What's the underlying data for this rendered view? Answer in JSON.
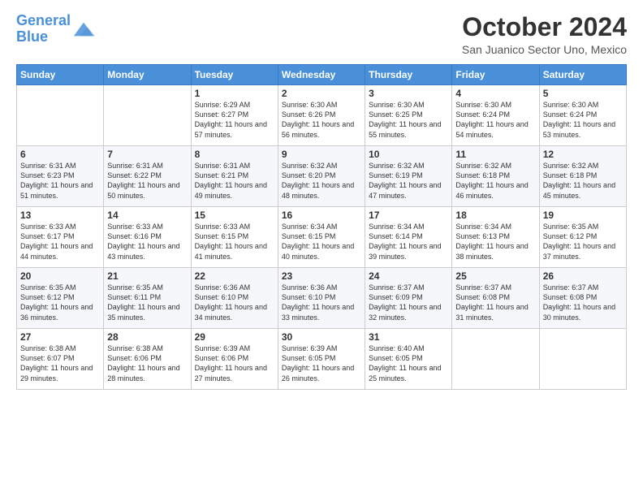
{
  "logo": {
    "line1": "General",
    "line2": "Blue"
  },
  "title": "October 2024",
  "subtitle": "San Juanico Sector Uno, Mexico",
  "header_days": [
    "Sunday",
    "Monday",
    "Tuesday",
    "Wednesday",
    "Thursday",
    "Friday",
    "Saturday"
  ],
  "weeks": [
    [
      {
        "day": "",
        "info": ""
      },
      {
        "day": "",
        "info": ""
      },
      {
        "day": "1",
        "info": "Sunrise: 6:29 AM\nSunset: 6:27 PM\nDaylight: 11 hours and 57 minutes."
      },
      {
        "day": "2",
        "info": "Sunrise: 6:30 AM\nSunset: 6:26 PM\nDaylight: 11 hours and 56 minutes."
      },
      {
        "day": "3",
        "info": "Sunrise: 6:30 AM\nSunset: 6:25 PM\nDaylight: 11 hours and 55 minutes."
      },
      {
        "day": "4",
        "info": "Sunrise: 6:30 AM\nSunset: 6:24 PM\nDaylight: 11 hours and 54 minutes."
      },
      {
        "day": "5",
        "info": "Sunrise: 6:30 AM\nSunset: 6:24 PM\nDaylight: 11 hours and 53 minutes."
      }
    ],
    [
      {
        "day": "6",
        "info": "Sunrise: 6:31 AM\nSunset: 6:23 PM\nDaylight: 11 hours and 51 minutes."
      },
      {
        "day": "7",
        "info": "Sunrise: 6:31 AM\nSunset: 6:22 PM\nDaylight: 11 hours and 50 minutes."
      },
      {
        "day": "8",
        "info": "Sunrise: 6:31 AM\nSunset: 6:21 PM\nDaylight: 11 hours and 49 minutes."
      },
      {
        "day": "9",
        "info": "Sunrise: 6:32 AM\nSunset: 6:20 PM\nDaylight: 11 hours and 48 minutes."
      },
      {
        "day": "10",
        "info": "Sunrise: 6:32 AM\nSunset: 6:19 PM\nDaylight: 11 hours and 47 minutes."
      },
      {
        "day": "11",
        "info": "Sunrise: 6:32 AM\nSunset: 6:18 PM\nDaylight: 11 hours and 46 minutes."
      },
      {
        "day": "12",
        "info": "Sunrise: 6:32 AM\nSunset: 6:18 PM\nDaylight: 11 hours and 45 minutes."
      }
    ],
    [
      {
        "day": "13",
        "info": "Sunrise: 6:33 AM\nSunset: 6:17 PM\nDaylight: 11 hours and 44 minutes."
      },
      {
        "day": "14",
        "info": "Sunrise: 6:33 AM\nSunset: 6:16 PM\nDaylight: 11 hours and 43 minutes."
      },
      {
        "day": "15",
        "info": "Sunrise: 6:33 AM\nSunset: 6:15 PM\nDaylight: 11 hours and 41 minutes."
      },
      {
        "day": "16",
        "info": "Sunrise: 6:34 AM\nSunset: 6:15 PM\nDaylight: 11 hours and 40 minutes."
      },
      {
        "day": "17",
        "info": "Sunrise: 6:34 AM\nSunset: 6:14 PM\nDaylight: 11 hours and 39 minutes."
      },
      {
        "day": "18",
        "info": "Sunrise: 6:34 AM\nSunset: 6:13 PM\nDaylight: 11 hours and 38 minutes."
      },
      {
        "day": "19",
        "info": "Sunrise: 6:35 AM\nSunset: 6:12 PM\nDaylight: 11 hours and 37 minutes."
      }
    ],
    [
      {
        "day": "20",
        "info": "Sunrise: 6:35 AM\nSunset: 6:12 PM\nDaylight: 11 hours and 36 minutes."
      },
      {
        "day": "21",
        "info": "Sunrise: 6:35 AM\nSunset: 6:11 PM\nDaylight: 11 hours and 35 minutes."
      },
      {
        "day": "22",
        "info": "Sunrise: 6:36 AM\nSunset: 6:10 PM\nDaylight: 11 hours and 34 minutes."
      },
      {
        "day": "23",
        "info": "Sunrise: 6:36 AM\nSunset: 6:10 PM\nDaylight: 11 hours and 33 minutes."
      },
      {
        "day": "24",
        "info": "Sunrise: 6:37 AM\nSunset: 6:09 PM\nDaylight: 11 hours and 32 minutes."
      },
      {
        "day": "25",
        "info": "Sunrise: 6:37 AM\nSunset: 6:08 PM\nDaylight: 11 hours and 31 minutes."
      },
      {
        "day": "26",
        "info": "Sunrise: 6:37 AM\nSunset: 6:08 PM\nDaylight: 11 hours and 30 minutes."
      }
    ],
    [
      {
        "day": "27",
        "info": "Sunrise: 6:38 AM\nSunset: 6:07 PM\nDaylight: 11 hours and 29 minutes."
      },
      {
        "day": "28",
        "info": "Sunrise: 6:38 AM\nSunset: 6:06 PM\nDaylight: 11 hours and 28 minutes."
      },
      {
        "day": "29",
        "info": "Sunrise: 6:39 AM\nSunset: 6:06 PM\nDaylight: 11 hours and 27 minutes."
      },
      {
        "day": "30",
        "info": "Sunrise: 6:39 AM\nSunset: 6:05 PM\nDaylight: 11 hours and 26 minutes."
      },
      {
        "day": "31",
        "info": "Sunrise: 6:40 AM\nSunset: 6:05 PM\nDaylight: 11 hours and 25 minutes."
      },
      {
        "day": "",
        "info": ""
      },
      {
        "day": "",
        "info": ""
      }
    ]
  ]
}
